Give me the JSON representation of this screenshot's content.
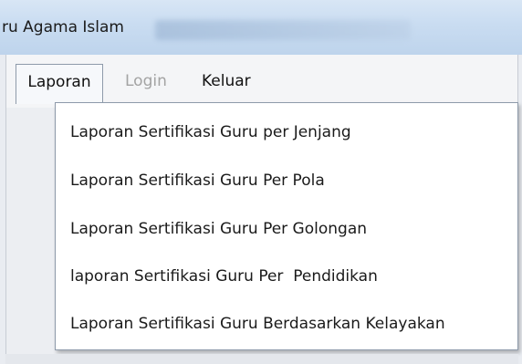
{
  "window": {
    "title": "ru Agama Islam"
  },
  "menubar": {
    "items": [
      {
        "label": "Laporan"
      },
      {
        "label": "Login"
      },
      {
        "label": "Keluar"
      }
    ]
  },
  "dropdown": {
    "items": [
      {
        "label": "Laporan Sertifikasi Guru per Jenjang"
      },
      {
        "label": "Laporan Sertifikasi Guru Per Pola"
      },
      {
        "label": "Laporan Sertifikasi Guru Per Golongan"
      },
      {
        "label": "laporan Sertifikasi Guru Per  Pendidikan"
      },
      {
        "label": "Laporan Sertifikasi Guru Berdasarkan Kelayakan"
      }
    ]
  }
}
